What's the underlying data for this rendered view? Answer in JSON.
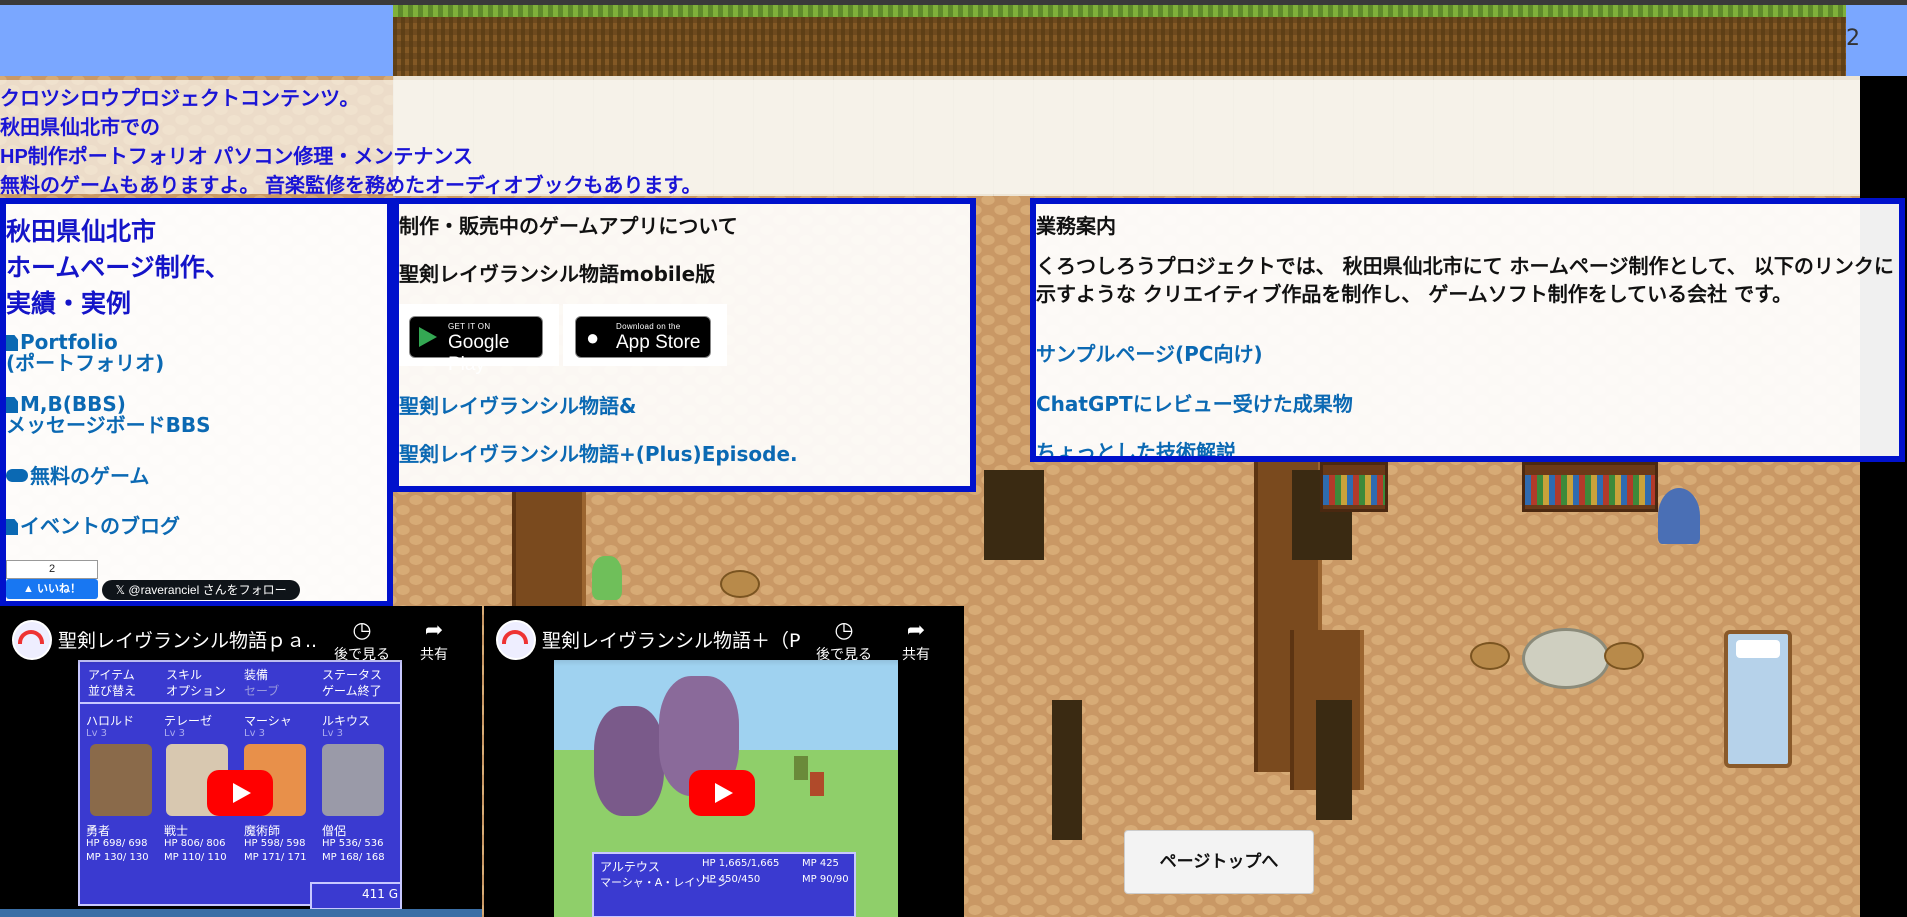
{
  "background": {
    "corner_number": "2",
    "colors": {
      "sky": "#7aa7ff",
      "floor": "#c99865",
      "panel_border": "#0011cc",
      "link": "#0b69b3",
      "heading": "#1414c8"
    }
  },
  "intro": {
    "lines": [
      "クロツシロウプロジェクトコンテンツ。",
      "秋田県仙北市での",
      "HP制作ポートフォリオ パソコン修理・メンテナンス",
      "無料のゲームもありますよ。 音楽監修を務めたオーディオブックもあります。"
    ]
  },
  "left_panel": {
    "title_lines": [
      "秋田県仙北市",
      "ホームページ制作、",
      "実績・実例"
    ],
    "links": [
      {
        "icon": "document-icon",
        "label_lines": [
          "Portfolio",
          "(ポートフォリオ)"
        ]
      },
      {
        "icon": "document-icon",
        "label_lines": [
          "M,B(BBS)",
          "メッセージボードBBS"
        ]
      },
      {
        "icon": "gamepad-icon",
        "label_lines": [
          "無料のゲーム"
        ]
      },
      {
        "icon": "document-icon",
        "label_lines": [
          "イベントのブログ"
        ]
      }
    ],
    "like": {
      "count": "2",
      "label": "いいね！"
    },
    "follow": {
      "label": "@raveranciel さんをフォロー"
    }
  },
  "mid_panel": {
    "heading": "制作・販売中のゲームアプリについて",
    "subheading": "聖剣レイヴランシル物語mobile版",
    "google_play": {
      "small": "GET IT ON",
      "big": "Google Play"
    },
    "app_store": {
      "small": "Download on the",
      "big": "App Store"
    },
    "links": [
      "聖剣レイヴランシル物語&",
      "聖剣レイヴランシル物語+(Plus)Episode."
    ]
  },
  "right_panel": {
    "heading": "業務案内",
    "paragraph": "くろつしろうプロジェクトでは、 秋田県仙北市にて ホームページ制作として、 以下のリンクに示すような クリエイティブ作品を制作し、 ゲームソフト制作をしている会社 です。",
    "links": [
      "サンプルページ(PC向け)",
      "ChatGPTにレビュー受けた成果物",
      "ちょっとした技術解説"
    ]
  },
  "videos": [
    {
      "title": "聖剣レイヴランシル物語ｐａ...",
      "watch_later": "後で見る",
      "share": "共有",
      "menu": {
        "commands": [
          "アイテム",
          "スキル",
          "装備",
          "ステータス",
          "並び替え",
          "オプション",
          "セーブ",
          "ゲーム終了"
        ],
        "members": [
          {
            "name": "ハロルド",
            "lv": "Lv 3",
            "job": "勇者",
            "hp": "HP 698/ 698",
            "mp": "MP 130/ 130"
          },
          {
            "name": "テレーゼ",
            "lv": "Lv 3",
            "job": "戦士",
            "hp": "HP 806/ 806",
            "mp": "MP 110/ 110"
          },
          {
            "name": "マーシャ",
            "lv": "Lv 3",
            "job": "魔術師",
            "hp": "HP 598/ 598",
            "mp": "MP 171/ 171"
          },
          {
            "name": "ルキウス",
            "lv": "Lv 3",
            "job": "僧侶",
            "hp": "HP 536/ 536",
            "mp": "MP 168/ 168"
          }
        ],
        "gold": "411 G"
      }
    },
    {
      "title": "聖剣レイヴランシル物語＋（Pl...",
      "watch_later": "後で見る",
      "share": "共有",
      "battle": {
        "rows": [
          {
            "name": "アルテウス",
            "hp": "HP 1,665/1,665",
            "mp": "MP 425"
          },
          {
            "name": "マーシャ・A・レイゾーン",
            "hp": "HP 450/450",
            "mp": "MP 90/90"
          }
        ]
      }
    }
  ],
  "page_top": {
    "label": "ページトップへ"
  }
}
